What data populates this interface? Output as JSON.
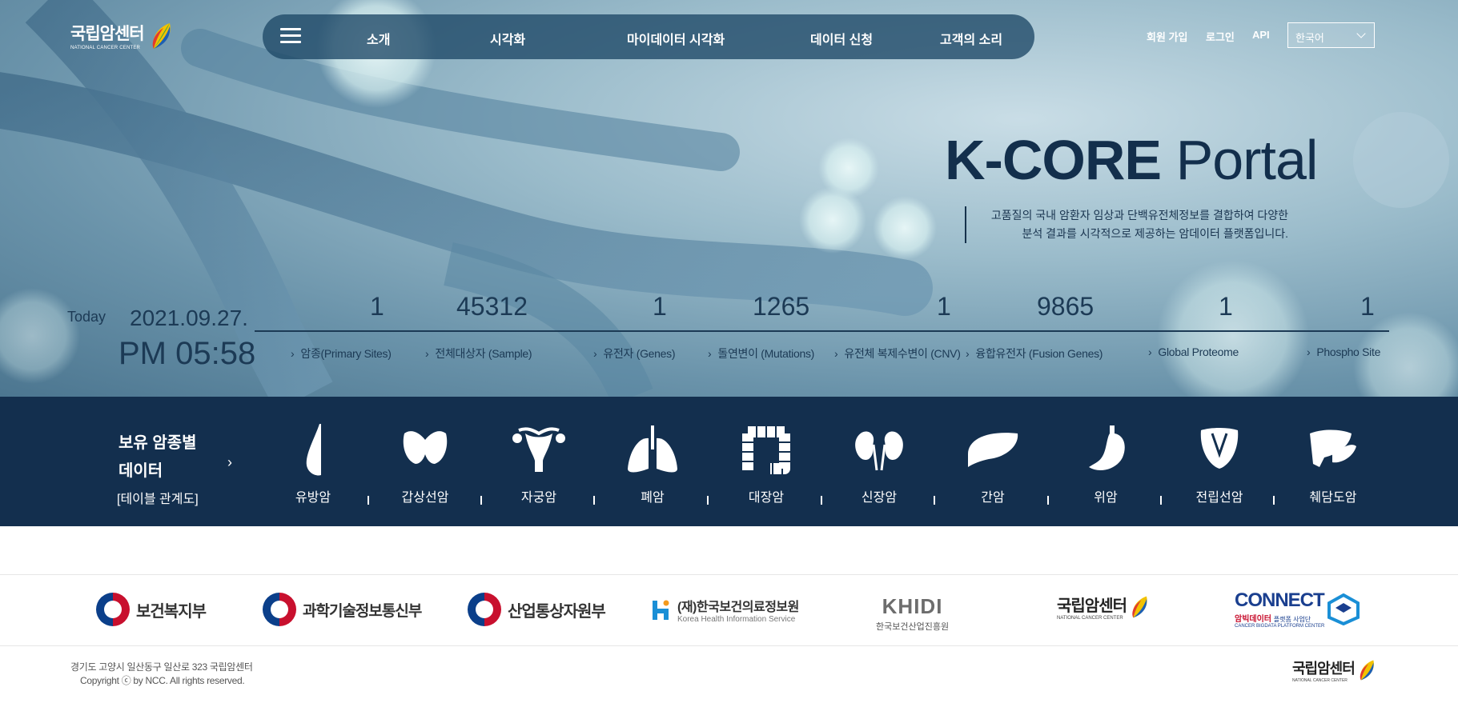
{
  "header": {
    "logo": {
      "name": "국립암센터",
      "sub": "NATIONAL CANCER CENTER"
    },
    "nav": [
      "소개",
      "시각화",
      "마이데이터 시각화",
      "데이터 신청",
      "고객의 소리"
    ],
    "util": {
      "signup": "회원 가입",
      "login": "로그인",
      "api": "API"
    },
    "language": "한국어"
  },
  "hero": {
    "title_bold": "K-CORE",
    "title_light": "Portal",
    "desc_line1": "고품질의 국내 암환자 임상과 단백유전체정보를 결합하여 다양한",
    "desc_line2": "분석 결과를 시각적으로 제공하는 암데이터 플랫폼입니다."
  },
  "today": {
    "label": "Today",
    "date": "2021.09.27.",
    "time": "PM 05:58"
  },
  "stats": [
    {
      "value": "1",
      "label": "암종(Primary Sites)"
    },
    {
      "value": "45312",
      "label": "전체대상자 (Sample)"
    },
    {
      "value": "1",
      "label": "유전자 (Genes)"
    },
    {
      "value": "1265",
      "label": "돌연변이 (Mutations)"
    },
    {
      "value": "1",
      "label": "유전체 복제수변이 (CNV)"
    },
    {
      "value": "9865",
      "label": "융합유전자 (Fusion Genes)"
    },
    {
      "value": "1",
      "label": "Global Proteome"
    },
    {
      "value": "1",
      "label": "Phospho Site"
    }
  ],
  "cancer_section": {
    "title_line1": "보유 암종별",
    "title_line2": "데이터",
    "subtitle": "[테이블 관계도]",
    "items": [
      {
        "label": "유방암",
        "icon": "breast-icon"
      },
      {
        "label": "갑상선암",
        "icon": "thyroid-icon"
      },
      {
        "label": "자궁암",
        "icon": "uterus-icon"
      },
      {
        "label": "폐암",
        "icon": "lungs-icon"
      },
      {
        "label": "대장암",
        "icon": "colon-icon"
      },
      {
        "label": "신장암",
        "icon": "kidney-icon"
      },
      {
        "label": "간암",
        "icon": "liver-icon"
      },
      {
        "label": "위암",
        "icon": "stomach-icon"
      },
      {
        "label": "전립선암",
        "icon": "prostate-icon"
      },
      {
        "label": "췌담도암",
        "icon": "pancreas-icon"
      }
    ]
  },
  "partners": {
    "mohw": "보건복지부",
    "msit": "과학기술정보통신부",
    "motie": "산업통상자원부",
    "khis_main": "(재)한국보건의료정보원",
    "khis_sub": "Korea Health Information Service",
    "khidi_main": "KHIDI",
    "khidi_sub": "한국보건산업진흥원",
    "ncc_main": "국립암센터",
    "ncc_sub": "NATIONAL CANCER CENTER",
    "connect_main": "CONNECT",
    "connect_kr": "암빅데이터",
    "connect_kr2": "플랫폼 사업단",
    "connect_sub": "CANCER BIGDATA PLATFORM CENTER"
  },
  "footer": {
    "address": "경기도 고양시 일산동구 일산로 323 국립암센터",
    "copyright": "Copyright ⓒ by NCC. All rights reserved.",
    "logo_name": "국립암센터",
    "logo_sub": "NATIONAL CANCER CENTER"
  },
  "colors": {
    "navy": "#132f4e",
    "hero_text": "#1c3a55",
    "nav_bg": "#1e4866"
  }
}
